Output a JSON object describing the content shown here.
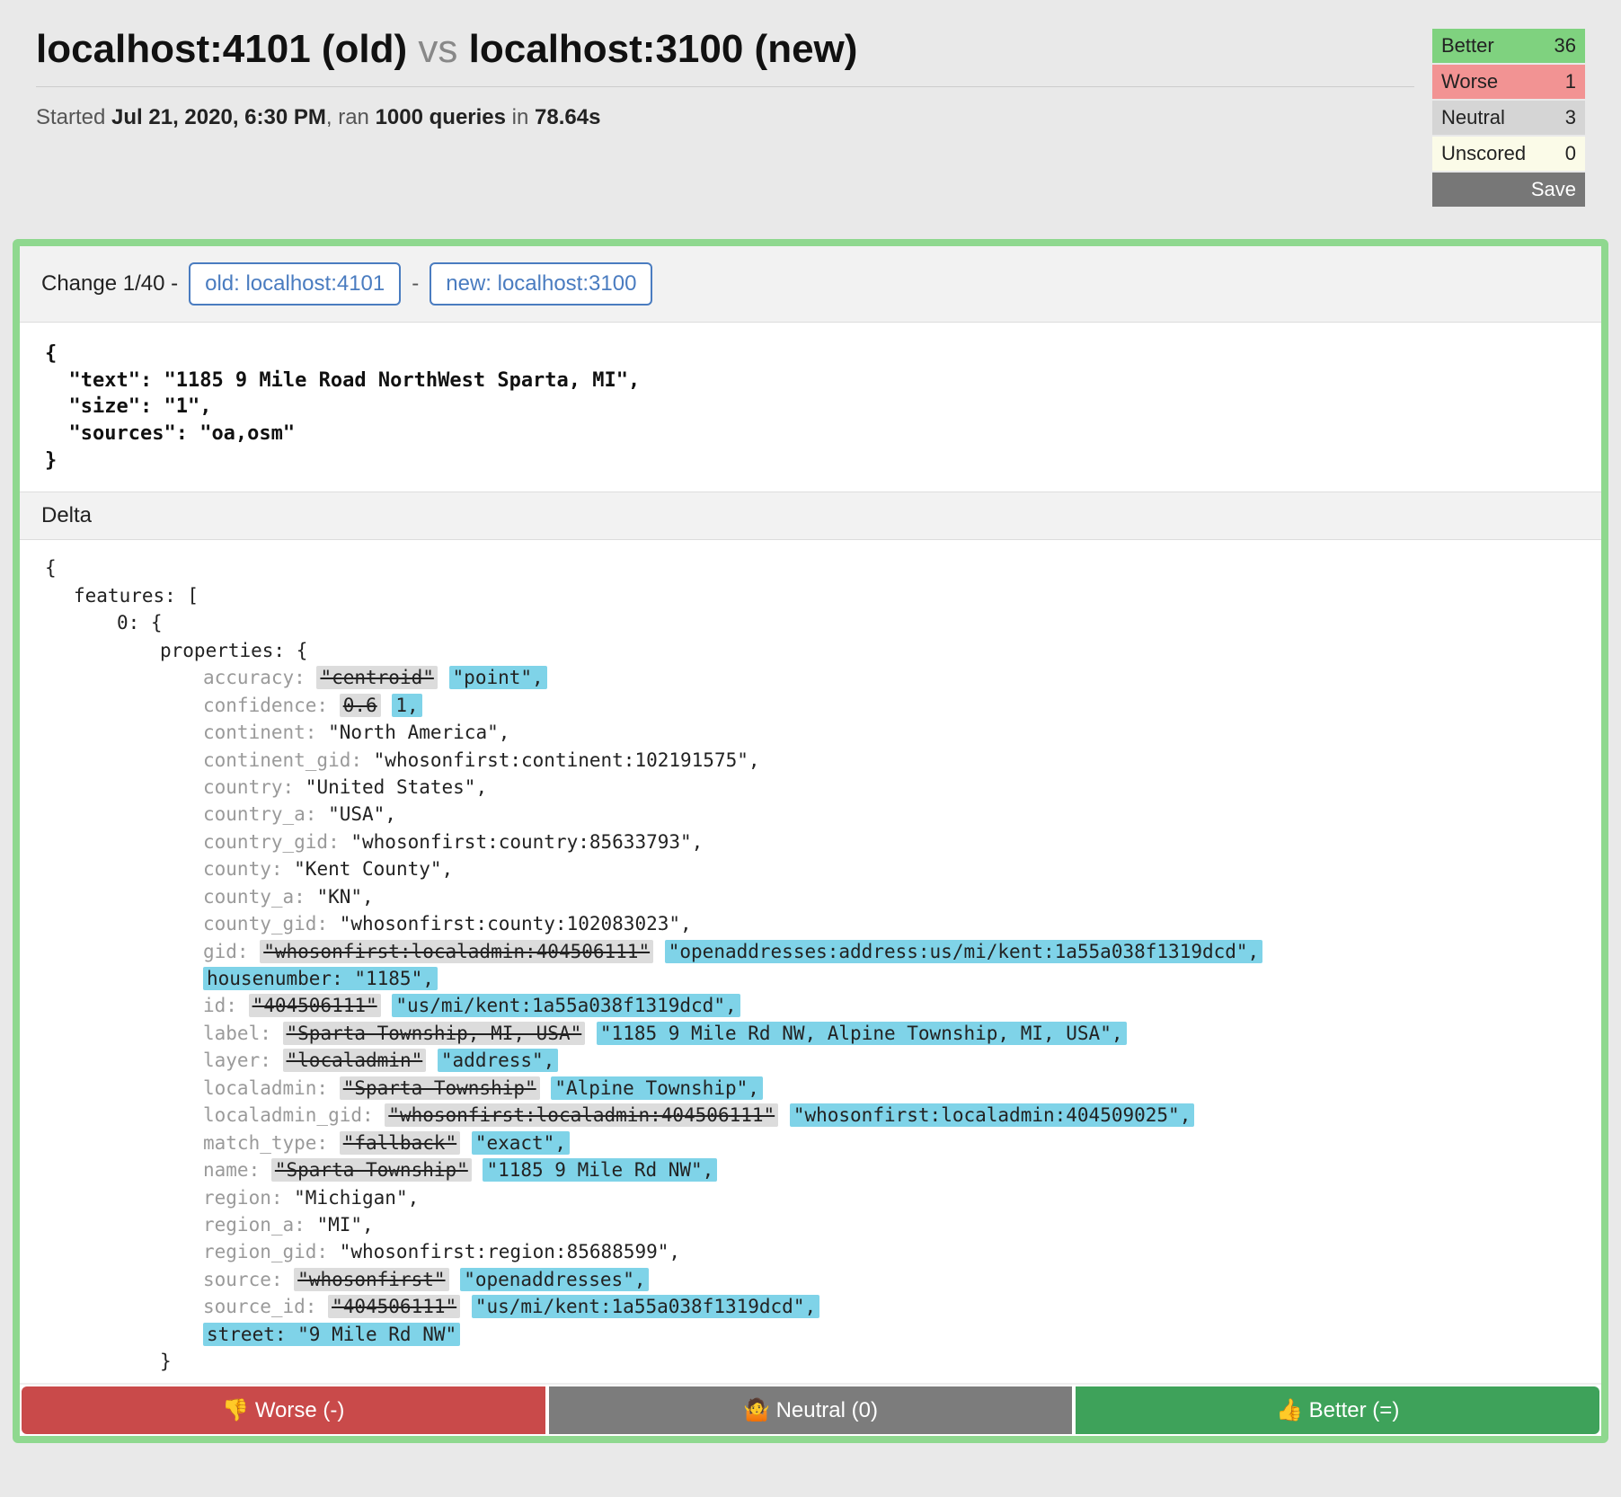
{
  "header": {
    "old_host": "localhost:4101 (old)",
    "vs": "vs",
    "new_host": "localhost:3100 (new)",
    "run_prefix": "Started ",
    "run_timestamp": "Jul 21, 2020, 6:30 PM",
    "run_mid": ", ran ",
    "run_queries": "1000 queries",
    "run_in": " in ",
    "run_duration": "78.64s"
  },
  "scores": {
    "better_label": "Better",
    "better_count": "36",
    "worse_label": "Worse",
    "worse_count": "1",
    "neutral_label": "Neutral",
    "neutral_count": "3",
    "unscored_label": "Unscored",
    "unscored_count": "0",
    "save_label": "Save"
  },
  "change": {
    "label": "Change 1/40 -",
    "old_btn": "old: localhost:4101",
    "new_btn": "new: localhost:3100",
    "sep": "-"
  },
  "query": {
    "l0": "{",
    "l1": "  \"text\": \"1185 9 Mile Road NorthWest Sparta, MI\",",
    "l2": "  \"size\": \"1\",",
    "l3": "  \"sources\": \"oa,osm\"",
    "l4": "}"
  },
  "delta": {
    "heading": "Delta",
    "open_brace": "{",
    "features_open": "features: [",
    "zero_open": "0: {",
    "properties_open": "properties: {",
    "close_brace": "}",
    "rows": [
      {
        "key": "accuracy:",
        "del": "\"centroid\"",
        "add": "\"point\",",
        "plain": null,
        "addline": null
      },
      {
        "key": "confidence:",
        "del": "0.6",
        "add": "1,",
        "plain": null,
        "addline": null
      },
      {
        "key": "continent:",
        "del": null,
        "add": null,
        "plain": "\"North America\",",
        "addline": null
      },
      {
        "key": "continent_gid:",
        "del": null,
        "add": null,
        "plain": "\"whosonfirst:continent:102191575\",",
        "addline": null
      },
      {
        "key": "country:",
        "del": null,
        "add": null,
        "plain": "\"United States\",",
        "addline": null
      },
      {
        "key": "country_a:",
        "del": null,
        "add": null,
        "plain": "\"USA\",",
        "addline": null
      },
      {
        "key": "country_gid:",
        "del": null,
        "add": null,
        "plain": "\"whosonfirst:country:85633793\",",
        "addline": null
      },
      {
        "key": "county:",
        "del": null,
        "add": null,
        "plain": "\"Kent County\",",
        "addline": null
      },
      {
        "key": "county_a:",
        "del": null,
        "add": null,
        "plain": "\"KN\",",
        "addline": null
      },
      {
        "key": "county_gid:",
        "del": null,
        "add": null,
        "plain": "\"whosonfirst:county:102083023\",",
        "addline": null
      },
      {
        "key": "gid:",
        "del": "\"whosonfirst:localadmin:404506111\"",
        "add": "\"openaddresses:address:us/mi/kent:1a55a038f1319dcd\",",
        "plain": null,
        "addline": null
      },
      {
        "key": null,
        "del": null,
        "add": null,
        "plain": null,
        "addline": "housenumber: \"1185\","
      },
      {
        "key": "id:",
        "del": "\"404506111\"",
        "add": "\"us/mi/kent:1a55a038f1319dcd\",",
        "plain": null,
        "addline": null
      },
      {
        "key": "label:",
        "del": "\"Sparta Township, MI, USA\"",
        "add": "\"1185 9 Mile Rd NW, Alpine Township, MI, USA\",",
        "plain": null,
        "addline": null
      },
      {
        "key": "layer:",
        "del": "\"localadmin\"",
        "add": "\"address\",",
        "plain": null,
        "addline": null
      },
      {
        "key": "localadmin:",
        "del": "\"Sparta Township\"",
        "add": "\"Alpine Township\",",
        "plain": null,
        "addline": null
      },
      {
        "key": "localadmin_gid:",
        "del": "\"whosonfirst:localadmin:404506111\"",
        "add": "\"whosonfirst:localadmin:404509025\",",
        "plain": null,
        "addline": null
      },
      {
        "key": "match_type:",
        "del": "\"fallback\"",
        "add": "\"exact\",",
        "plain": null,
        "addline": null
      },
      {
        "key": "name:",
        "del": "\"Sparta Township\"",
        "add": "\"1185 9 Mile Rd NW\",",
        "plain": null,
        "addline": null
      },
      {
        "key": "region:",
        "del": null,
        "add": null,
        "plain": "\"Michigan\",",
        "addline": null
      },
      {
        "key": "region_a:",
        "del": null,
        "add": null,
        "plain": "\"MI\",",
        "addline": null
      },
      {
        "key": "region_gid:",
        "del": null,
        "add": null,
        "plain": "\"whosonfirst:region:85688599\",",
        "addline": null
      },
      {
        "key": "source:",
        "del": "\"whosonfirst\"",
        "add": "\"openaddresses\",",
        "plain": null,
        "addline": null
      },
      {
        "key": "source_id:",
        "del": "\"404506111\"",
        "add": "\"us/mi/kent:1a55a038f1319dcd\",",
        "plain": null,
        "addline": null
      },
      {
        "key": null,
        "del": null,
        "add": null,
        "plain": null,
        "addline": "street: \"9 Mile Rd NW\""
      }
    ]
  },
  "votes": {
    "worse_emoji": "👎",
    "worse_label": " Worse (-)",
    "neutral_emoji": "🤷",
    "neutral_label": " Neutral (0)",
    "better_emoji": "👍",
    "better_label": " Better (=)"
  }
}
